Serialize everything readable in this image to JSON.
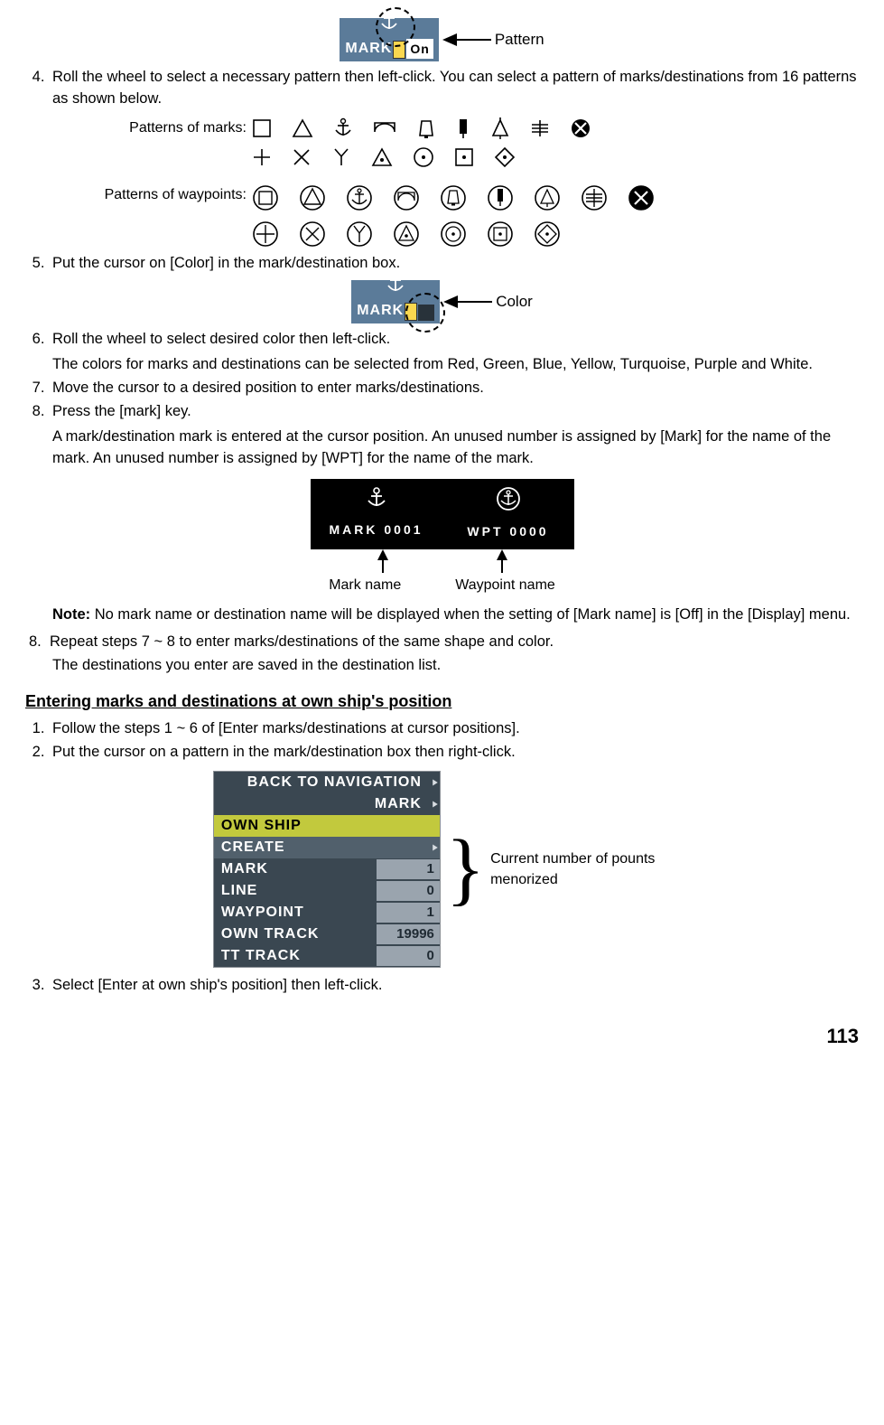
{
  "fig1": {
    "label": "MARK",
    "swatch": true,
    "on": "On",
    "callout": "Pattern"
  },
  "step4": "Roll the wheel to select a necessary pattern then left-click. You can select a pattern of marks/destinations from 16 patterns as shown below.",
  "patterns_marks_label": "Patterns of marks:",
  "patterns_waypoints_label": "Patterns of waypoints:",
  "step5": "Put the cursor on [Color] in the mark/destination box.",
  "fig2": {
    "label": "MARK",
    "callout": "Color"
  },
  "step6": "Roll the wheel to select desired color then left-click.",
  "step6_sub": "The colors for marks and destinations can be selected from Red, Green, Blue, Yellow, Turquoise, Purple and White.",
  "step7": "Move the cursor to a desired position to enter marks/destinations.",
  "step8": "Press the [mark] key.",
  "step8_sub": "A mark/destination mark is entered at the cursor position. An unused number is assigned by [Mark] for the name of the mark. An unused number is assigned by [WPT] for the name of the mark.",
  "markwpt": {
    "mark": "MARK 0001",
    "wpt": "WPT 0000",
    "mark_label": "Mark name",
    "wpt_label": "Waypoint name"
  },
  "note_bold": "Note:",
  "note_text": " No mark name or destination name will be displayed when the setting of [Mark name] is [Off] in the [Display] menu.",
  "step8b": " Repeat steps 7 ~ 8 to enter marks/destinations of the same shape and color.",
  "step8b_sub": "The destinations you enter are saved in the destination list.",
  "section2": "Entering marks and destinations at own ship's position",
  "s2_step1": "Follow the steps 1 ~ 6 of [Enter marks/destinations at cursor positions].",
  "s2_step2": "Put the cursor on a pattern in the mark/destination box then right-click.",
  "menu": {
    "back": "BACK TO NAVIGATION",
    "mark": "MARK",
    "own_ship": "OWN SHIP",
    "create": "CREATE",
    "rows": [
      {
        "label": "MARK",
        "val": "1"
      },
      {
        "label": "LINE",
        "val": "0"
      },
      {
        "label": "WAYPOINT",
        "val": "1"
      },
      {
        "label": "OWN TRACK",
        "val": "19996"
      },
      {
        "label": "TT TRACK",
        "val": "0"
      }
    ],
    "side": "Current number of pounts menorized"
  },
  "s2_step3": "Select [Enter at own ship's position] then left-click.",
  "page": "113"
}
